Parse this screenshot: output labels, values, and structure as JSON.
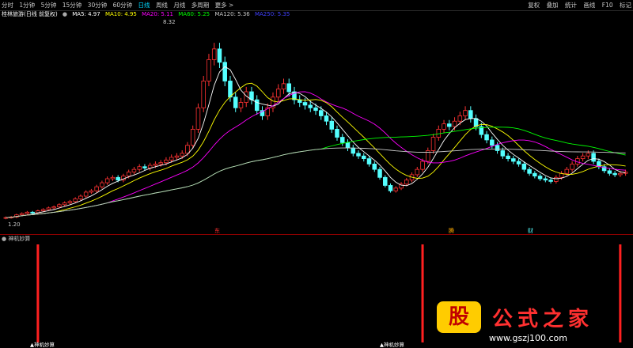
{
  "toolbar": {
    "periods": [
      "分时",
      "1分钟",
      "5分钟",
      "15分钟",
      "30分钟",
      "60分钟",
      "日线",
      "周线",
      "月线",
      "多周期",
      "更多 >"
    ],
    "active_period": "日线",
    "right_buttons": [
      "复权",
      "叠加",
      "统计",
      "画线",
      "F10",
      "标记"
    ]
  },
  "title": {
    "stock": "桂林旅游(日线 前复权)",
    "ma5": "MA5: 4.97",
    "ma10": "MA10: 4.95",
    "ma20": "MA20: 5.11",
    "ma60": "MA60: 5.25",
    "ma120": "MA120: 5.36",
    "ma250": "MA250: 5.35"
  },
  "colors": {
    "up": "#ff3232",
    "down": "#54ffff",
    "ma5": "#ffffff",
    "ma10": "#ffff00",
    "ma20": "#ff00ff",
    "ma60": "#00ff00",
    "ma120": "#c8c8c8",
    "ma250": "#4040ff"
  },
  "price_labels": {
    "high": "8.32",
    "low": "1.20"
  },
  "event_markers": [
    "东",
    "腾",
    "财"
  ],
  "indicator": {
    "title": "神机妙算",
    "signal_label": "神机妙算"
  },
  "logo": {
    "gu": "股",
    "name": "公式之家",
    "url": "www.gszj100.com"
  },
  "chart_data": {
    "type": "candlestick",
    "notes": "Daily price series, approximate",
    "high_label": 8.32,
    "low_label": 1.2,
    "ylim": [
      0.8,
      8.6
    ],
    "closes": [
      1.3,
      1.32,
      1.4,
      1.45,
      1.5,
      1.48,
      1.55,
      1.6,
      1.66,
      1.7,
      1.78,
      1.85,
      1.9,
      2.0,
      2.1,
      2.25,
      2.3,
      2.45,
      2.6,
      2.75,
      2.8,
      2.7,
      2.85,
      3.0,
      3.1,
      3.2,
      3.15,
      3.25,
      3.3,
      3.35,
      3.45,
      3.55,
      3.6,
      3.7,
      4.0,
      4.6,
      5.4,
      6.4,
      7.2,
      7.6,
      7.1,
      6.4,
      5.8,
      5.4,
      5.6,
      6.0,
      5.7,
      5.3,
      5.1,
      5.4,
      5.8,
      6.1,
      6.3,
      6.0,
      5.7,
      5.6,
      5.5,
      5.4,
      5.3,
      5.1,
      4.9,
      4.6,
      4.3,
      4.1,
      3.9,
      3.7,
      3.6,
      3.5,
      3.3,
      3.1,
      2.8,
      2.5,
      2.3,
      2.4,
      2.55,
      2.7,
      2.9,
      3.1,
      3.4,
      3.8,
      4.3,
      4.6,
      4.8,
      4.7,
      4.9,
      5.1,
      5.3,
      5.0,
      4.7,
      4.4,
      4.2,
      4.0,
      3.8,
      3.6,
      3.5,
      3.4,
      3.3,
      3.1,
      2.95,
      2.85,
      2.75,
      2.7,
      2.65,
      2.8,
      2.95,
      3.1,
      3.3,
      3.5,
      3.6,
      3.7,
      3.4,
      3.2,
      3.05,
      2.95,
      2.9,
      2.95,
      3.0
    ],
    "signals": [
      6,
      78,
      115
    ]
  }
}
